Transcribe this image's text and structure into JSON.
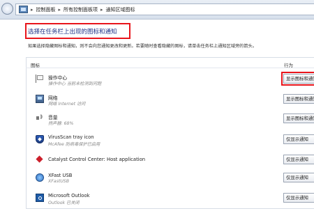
{
  "breadcrumb": {
    "items": [
      "控制面板",
      "所有控制面板项",
      "通知区域图标"
    ],
    "separator": "▸"
  },
  "page": {
    "title": "选择在任务栏上出现的图标和通知",
    "description": "如果选择隐藏图标和通知，则不会向您通知更改和更新。若要随时查看隐藏的图标，请单击任务栏上通知区域旁的箭头。"
  },
  "table": {
    "col_icon": "图标",
    "col_behavior": "行为",
    "rows": [
      {
        "name": "操作中心",
        "sub": "操作中心 当前未检测到问题",
        "behavior": "显示图标和通知",
        "icon": "flag-icon",
        "highlight": true
      },
      {
        "name": "网络",
        "sub": "网络 Internet 访问",
        "behavior": "显示图标和通知",
        "icon": "network-icon",
        "highlight": false
      },
      {
        "name": "音量",
        "sub": "扬声器: 68%",
        "behavior": "显示图标和通知",
        "icon": "volume-icon",
        "highlight": false
      },
      {
        "name": "VirusScan tray icon",
        "sub": "McAfee 防病毒保护已启用",
        "behavior": "仅显示通知",
        "icon": "mcafee-shield-icon",
        "highlight": false
      },
      {
        "name": "Catalyst Control Center: Host application",
        "sub": "",
        "behavior": "仅显示通知",
        "icon": "catalyst-icon",
        "highlight": false
      },
      {
        "name": "XFast USB",
        "sub": "XFastUSB",
        "behavior": "仅显示通知",
        "icon": "xfast-usb-icon",
        "highlight": false
      },
      {
        "name": "Microsoft Outlook",
        "sub": "Outlook 已关闭",
        "behavior": "仅显示通知",
        "icon": "outlook-icon",
        "highlight": false
      }
    ]
  },
  "colors": {
    "highlight_border": "#e8141b",
    "title_text": "#1e3287"
  }
}
